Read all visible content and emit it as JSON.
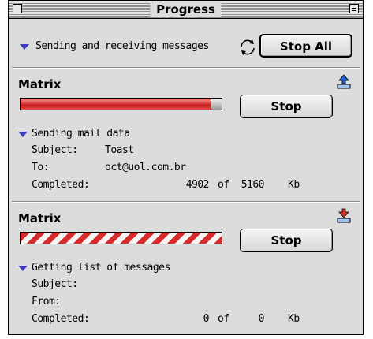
{
  "window": {
    "title": "Progress",
    "header_label": "Sending and receiving messages",
    "stop_all_label": "Stop All"
  },
  "tasks": [
    {
      "account": "Matrix",
      "progress_fraction": 0.95,
      "progress_style": "determinate",
      "stop_label": "Stop",
      "icon": "upload-arrow-icon",
      "status": "Sending mail data",
      "fields": [
        {
          "label": "Subject:",
          "value": "Toast"
        },
        {
          "label": "To:",
          "value": "oct@uol.com.br"
        }
      ],
      "completed_label": "Completed:",
      "completed_value": "4902",
      "of_label": "of",
      "total_value": "5160",
      "unit": "Kb"
    },
    {
      "account": "Matrix",
      "progress_style": "indeterminate",
      "stop_label": "Stop",
      "icon": "download-arrow-icon",
      "status": "Getting list of messages",
      "fields": [
        {
          "label": "Subject:",
          "value": ""
        },
        {
          "label": "From:",
          "value": ""
        }
      ],
      "completed_label": "Completed:",
      "completed_value": "0",
      "of_label": "of",
      "total_value": "0",
      "unit": "Kb"
    }
  ],
  "colors": {
    "progress_red": "#c71e1e",
    "disclosure_triangle": "#3d3dbe",
    "window_bg": "#dcdcdc"
  }
}
